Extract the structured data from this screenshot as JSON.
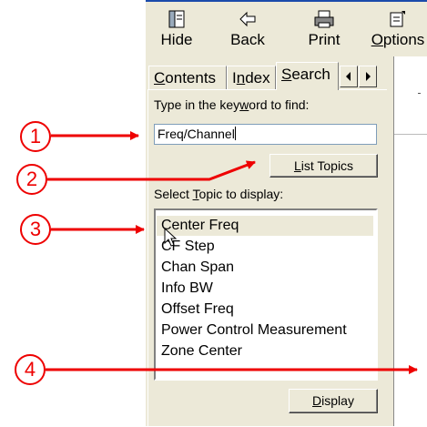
{
  "toolbar": {
    "hide_label": "Hide",
    "back_label": "Back",
    "print_label": "Print",
    "options_label_pre": "",
    "options_label_ul": "O",
    "options_label_post": "ptions"
  },
  "tabs": [
    {
      "pre": "",
      "ul": "C",
      "post": "ontents"
    },
    {
      "pre": "I",
      "ul": "n",
      "post": "dex"
    },
    {
      "pre": "",
      "ul": "S",
      "post": "earch"
    }
  ],
  "search": {
    "prompt_pre": "Type in the key",
    "prompt_ul": "w",
    "prompt_post": "ord to find:",
    "keyword_value": "Freq/Channel",
    "list_topics_pre": "",
    "list_topics_ul": "L",
    "list_topics_post": "ist Topics",
    "select_pre": "Select ",
    "select_ul": "T",
    "select_post": "opic to display:",
    "display_pre": "",
    "display_ul": "D",
    "display_post": "isplay"
  },
  "topics": [
    "Center Freq",
    "CF Step",
    "Chan Span",
    "Info BW",
    "Offset Freq",
    "Power Control Measurement",
    "Zone Center"
  ],
  "callouts": [
    "1",
    "2",
    "3",
    "4"
  ],
  "colors": {
    "annotation_red": "#ee0000",
    "panel_bg": "#ece9d8",
    "titlebar_blue": "#1b4bab"
  }
}
